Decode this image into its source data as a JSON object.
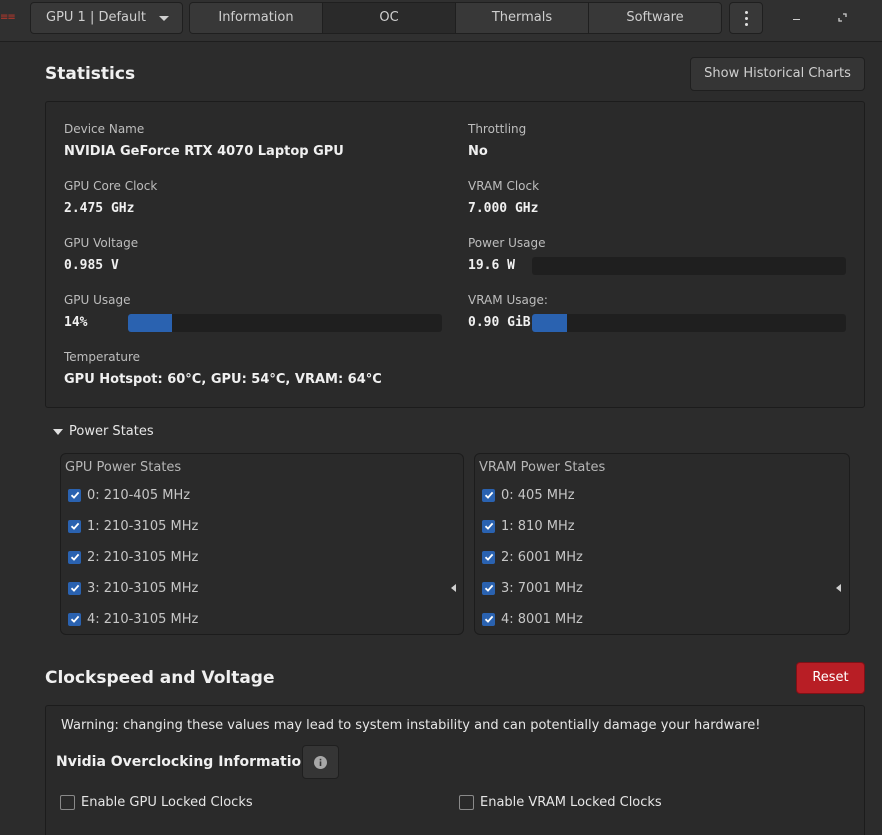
{
  "header": {
    "app_mark": "≡≡",
    "gpu_selector": "GPU 1 | Default",
    "tabs": [
      {
        "label": "Information",
        "active": false
      },
      {
        "label": "OC",
        "active": true
      },
      {
        "label": "Thermals",
        "active": false
      },
      {
        "label": "Software",
        "active": false
      }
    ],
    "icons": {
      "menu": "kebab-menu-icon",
      "minimize": "minimize-icon",
      "maximize": "maximize-icon"
    }
  },
  "statistics": {
    "title": "Statistics",
    "historical_button": "Show Historical Charts",
    "device_name_label": "Device Name",
    "device_name": "NVIDIA GeForce RTX 4070 Laptop GPU",
    "throttling_label": "Throttling",
    "throttling": "No",
    "core_clock_label": "GPU Core Clock",
    "core_clock": "2.475 GHz",
    "vram_clock_label": "VRAM Clock",
    "vram_clock": "7.000 GHz",
    "voltage_label": "GPU Voltage",
    "voltage": "0.985 V",
    "power_label": "Power Usage",
    "power": "19.6 W",
    "power_fraction": 0.0,
    "gpu_usage_label": "GPU Usage",
    "gpu_usage": "14%",
    "gpu_usage_fraction": 0.14,
    "vram_usage_label": "VRAM Usage:",
    "vram_usage": "0.90 GiB",
    "vram_usage_fraction": 0.11,
    "temperature_label": "Temperature",
    "temperature": "GPU Hotspot: 60°C, GPU: 54°C, VRAM: 64°C"
  },
  "power_states": {
    "label": "Power States",
    "gpu": {
      "header": "GPU Power States",
      "items": [
        {
          "label": "0: 210-405 MHz",
          "checked": true
        },
        {
          "label": "1: 210-3105 MHz",
          "checked": true
        },
        {
          "label": "2: 210-3105 MHz",
          "checked": true
        },
        {
          "label": "3: 210-3105 MHz",
          "checked": true
        },
        {
          "label": "4: 210-3105 MHz",
          "checked": true
        }
      ]
    },
    "vram": {
      "header": "VRAM Power States",
      "items": [
        {
          "label": "0: 405 MHz",
          "checked": true
        },
        {
          "label": "1: 810 MHz",
          "checked": true
        },
        {
          "label": "2: 6001 MHz",
          "checked": true
        },
        {
          "label": "3: 7001 MHz",
          "checked": true
        },
        {
          "label": "4: 8001 MHz",
          "checked": true
        }
      ]
    }
  },
  "clockspeed": {
    "title": "Clockspeed and Voltage",
    "reset_button": "Reset",
    "warning": "Warning: changing these values may lead to system instability and can potentially damage your hardware!",
    "oc_info_title": "Nvidia Overclocking Information",
    "gpu_locked_label": "Enable GPU Locked Clocks",
    "vram_locked_label": "Enable VRAM Locked Clocks"
  },
  "colors": {
    "accent": "#2a62b0",
    "danger": "#b81e25",
    "background": "#2c2c2c"
  }
}
